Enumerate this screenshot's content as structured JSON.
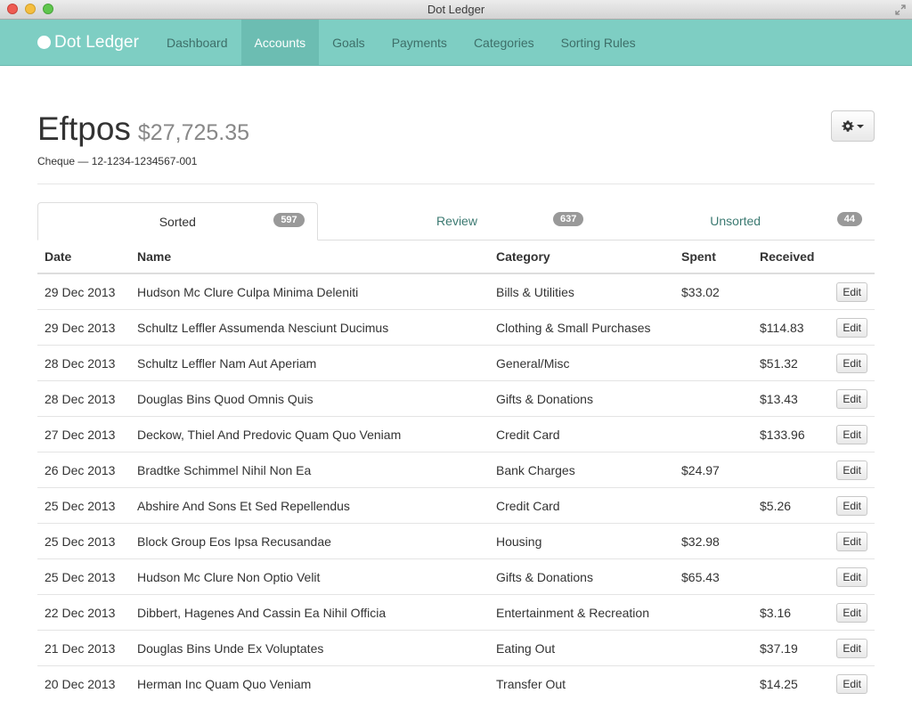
{
  "window": {
    "title": "Dot Ledger"
  },
  "nav": {
    "brand": "Dot Ledger",
    "items": [
      "Dashboard",
      "Accounts",
      "Goals",
      "Payments",
      "Categories",
      "Sorting Rules"
    ],
    "active": "Accounts"
  },
  "account": {
    "name": "Eftpos",
    "balance": "$27,725.35",
    "subtitle": "Cheque — 12-1234-1234567-001"
  },
  "tabs": [
    {
      "label": "Sorted",
      "count": "597",
      "active": true
    },
    {
      "label": "Review",
      "count": "637",
      "active": false
    },
    {
      "label": "Unsorted",
      "count": "44",
      "active": false
    }
  ],
  "table": {
    "headers": [
      "Date",
      "Name",
      "Category",
      "Spent",
      "Received",
      ""
    ],
    "edit_label": "Edit",
    "rows": [
      {
        "date": "29 Dec 2013",
        "name": "Hudson Mc Clure Culpa Minima Deleniti",
        "category": "Bills & Utilities",
        "spent": "$33.02",
        "received": ""
      },
      {
        "date": "29 Dec 2013",
        "name": "Schultz Leffler Assumenda Nesciunt Ducimus",
        "category": "Clothing & Small Purchases",
        "spent": "",
        "received": "$114.83"
      },
      {
        "date": "28 Dec 2013",
        "name": "Schultz Leffler Nam Aut Aperiam",
        "category": "General/Misc",
        "spent": "",
        "received": "$51.32"
      },
      {
        "date": "28 Dec 2013",
        "name": "Douglas Bins Quod Omnis Quis",
        "category": "Gifts & Donations",
        "spent": "",
        "received": "$13.43"
      },
      {
        "date": "27 Dec 2013",
        "name": "Deckow, Thiel And Predovic Quam Quo Veniam",
        "category": "Credit Card",
        "spent": "",
        "received": "$133.96"
      },
      {
        "date": "26 Dec 2013",
        "name": "Bradtke Schimmel Nihil Non Ea",
        "category": "Bank Charges",
        "spent": "$24.97",
        "received": ""
      },
      {
        "date": "25 Dec 2013",
        "name": "Abshire And Sons Et Sed Repellendus",
        "category": "Credit Card",
        "spent": "",
        "received": "$5.26"
      },
      {
        "date": "25 Dec 2013",
        "name": "Block Group Eos Ipsa Recusandae",
        "category": "Housing",
        "spent": "$32.98",
        "received": ""
      },
      {
        "date": "25 Dec 2013",
        "name": "Hudson Mc Clure Non Optio Velit",
        "category": "Gifts & Donations",
        "spent": "$65.43",
        "received": ""
      },
      {
        "date": "22 Dec 2013",
        "name": "Dibbert, Hagenes And Cassin Ea Nihil Officia",
        "category": "Entertainment & Recreation",
        "spent": "",
        "received": "$3.16"
      },
      {
        "date": "21 Dec 2013",
        "name": "Douglas Bins Unde Ex Voluptates",
        "category": "Eating Out",
        "spent": "",
        "received": "$37.19"
      },
      {
        "date": "20 Dec 2013",
        "name": "Herman Inc Quam Quo Veniam",
        "category": "Transfer Out",
        "spent": "",
        "received": "$14.25"
      }
    ]
  },
  "colors": {
    "navbar": "#7ecec3",
    "nav_active": "#6cbdb2",
    "link": "#3c7a72",
    "badge": "#999999"
  }
}
